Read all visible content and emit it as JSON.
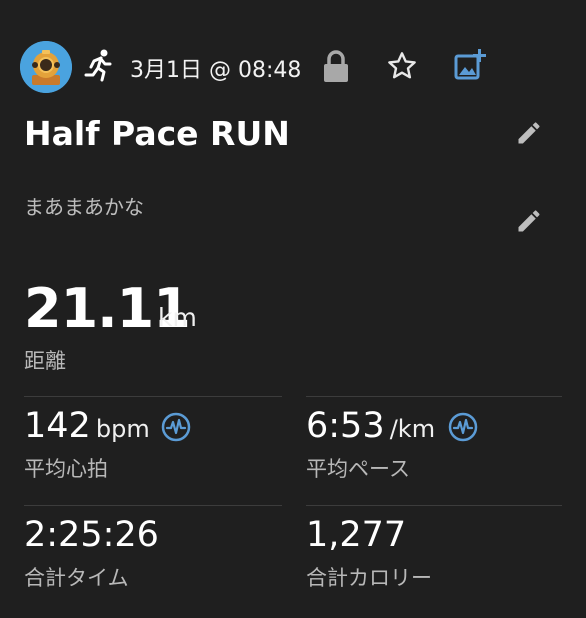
{
  "header": {
    "date_time": "3月1日 @ 08:48",
    "avatar": "diver-helmet-avatar",
    "activity_icon": "running-icon",
    "lock_icon": "lock-icon",
    "favorite_icon": "star-outline-icon",
    "add_photo_icon": "add-photo-icon"
  },
  "activity": {
    "title": "Half Pace RUN",
    "description": "まあまあかな"
  },
  "distance": {
    "value": "21.11",
    "unit": "km",
    "label": "距離"
  },
  "stats": {
    "avg_hr": {
      "value": "142",
      "unit": "bpm",
      "label": "平均心拍"
    },
    "avg_pace": {
      "value": "6:53",
      "unit": "/km",
      "label": "平均ペース"
    },
    "total_time": {
      "value": "2:25:26",
      "label": "合計タイム"
    },
    "total_calories": {
      "value": "1,277",
      "label": "合計カロリー"
    }
  },
  "colors": {
    "background": "#1f1f1f",
    "accent": "#5b9bd5",
    "text": "#ffffff",
    "muted": "#b8b8b8"
  }
}
